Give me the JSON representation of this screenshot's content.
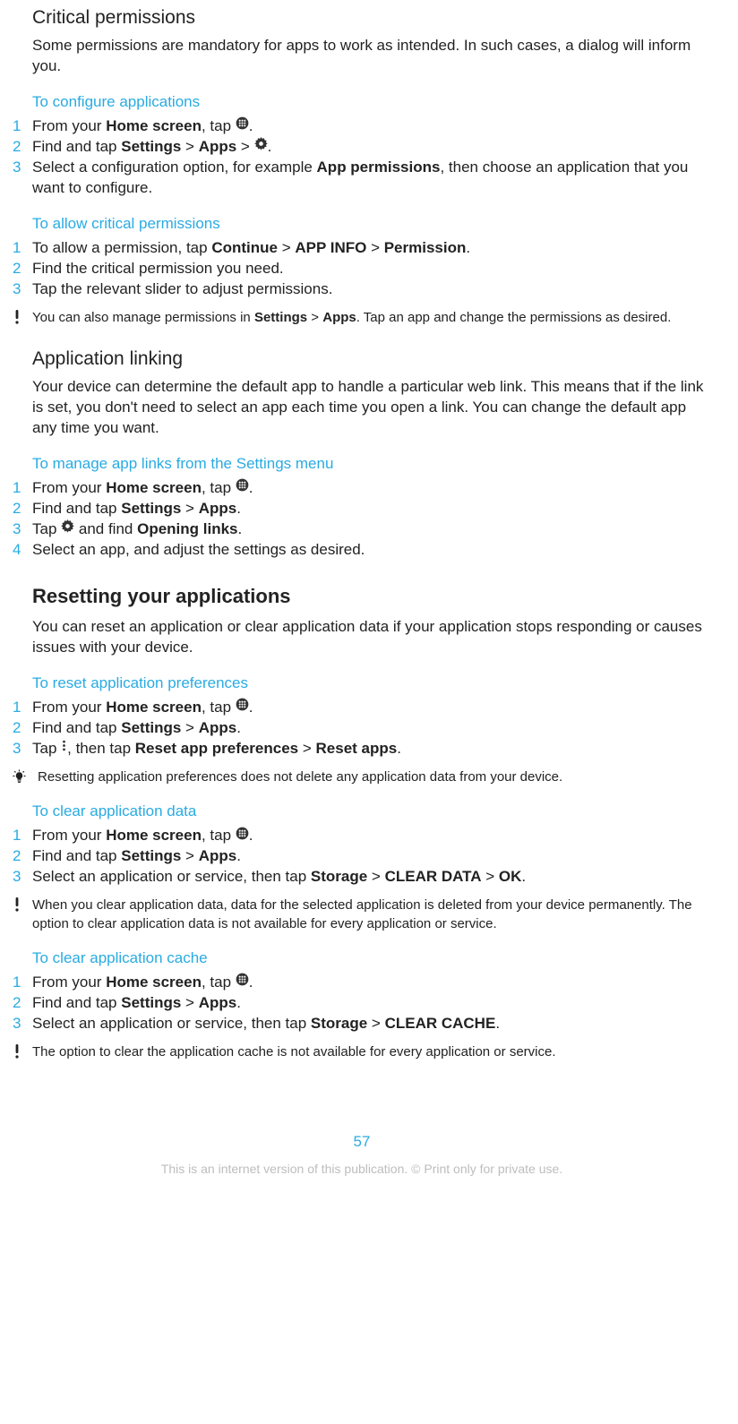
{
  "sections": {
    "critical": {
      "title": "Critical permissions",
      "intro": "Some permissions are mandatory for apps to work as intended. In such cases, a dialog will inform you."
    },
    "configure": {
      "title": "To configure applications",
      "step1_a": "From your ",
      "step1_b": "Home screen",
      "step1_c": ", tap ",
      "step2_a": "Find and tap ",
      "step2_b": "Settings",
      "step2_c": " > ",
      "step2_d": "Apps",
      "step2_e": " > ",
      "step3_a": "Select a configuration option, for example ",
      "step3_b": "App permissions",
      "step3_c": ", then choose an application that you want to configure."
    },
    "allow": {
      "title": "To allow critical permissions",
      "step1_a": "To allow a permission, tap ",
      "step1_b": "Continue",
      "step1_c": " > ",
      "step1_d": "APP INFO",
      "step1_e": " > ",
      "step1_f": "Permission",
      "step1_g": ".",
      "step2": "Find the critical permission you need.",
      "step3": "Tap the relevant slider to adjust permissions.",
      "note_a": "You can also manage permissions in ",
      "note_b": "Settings",
      "note_c": " > ",
      "note_d": "Apps",
      "note_e": ". Tap an app and change the permissions as desired."
    },
    "linking": {
      "title": "Application linking",
      "intro": "Your device can determine the default app to handle a particular web link. This means that if the link is set, you don't need to select an app each time you open a link. You can change the default app any time you want.",
      "sub": "To manage app links from the Settings menu",
      "step1_a": "From your ",
      "step1_b": "Home screen",
      "step1_c": ", tap ",
      "step2_a": "Find and tap ",
      "step2_b": "Settings",
      "step2_c": " > ",
      "step2_d": "Apps",
      "step2_e": ".",
      "step3_a": "Tap ",
      "step3_b": " and find ",
      "step3_c": "Opening links",
      "step3_d": ".",
      "step4": "Select an app, and adjust the settings as desired."
    },
    "reset": {
      "title": "Resetting your applications",
      "intro": "You can reset an application or clear application data if your application stops responding or causes issues with your device."
    },
    "resetprefs": {
      "title": "To reset application preferences",
      "step1_a": "From your ",
      "step1_b": "Home screen",
      "step1_c": ", tap ",
      "step2_a": "Find and tap ",
      "step2_b": "Settings",
      "step2_c": " > ",
      "step2_d": "Apps",
      "step2_e": ".",
      "step3_a": "Tap ",
      "step3_b": ", then tap ",
      "step3_c": "Reset app preferences",
      "step3_d": " > ",
      "step3_e": "Reset apps",
      "step3_f": ".",
      "note": "Resetting application preferences does not delete any application data from your device."
    },
    "cleardata": {
      "title": "To clear application data",
      "step1_a": "From your ",
      "step1_b": "Home screen",
      "step1_c": ", tap ",
      "step2_a": "Find and tap ",
      "step2_b": "Settings",
      "step2_c": " > ",
      "step2_d": "Apps",
      "step2_e": ".",
      "step3_a": "Select an application or service, then tap ",
      "step3_b": "Storage",
      "step3_c": " > ",
      "step3_d": "CLEAR DATA",
      "step3_e": " > ",
      "step3_f": "OK",
      "step3_g": ".",
      "note": "When you clear application data, data for the selected application is deleted from your device permanently. The option to clear application data is not available for every application or service."
    },
    "clearcache": {
      "title": "To clear application cache",
      "step1_a": "From your ",
      "step1_b": "Home screen",
      "step1_c": ", tap ",
      "step2_a": "Find and tap ",
      "step2_b": "Settings",
      "step2_c": " > ",
      "step2_d": "Apps",
      "step2_e": ".",
      "step3_a": "Select an application or service, then tap ",
      "step3_b": "Storage",
      "step3_c": " > ",
      "step3_d": "CLEAR CACHE",
      "step3_e": ".",
      "note": "The option to clear the application cache is not available for every application or service."
    }
  },
  "page_number": "57",
  "footer": "This is an internet version of this publication. © Print only for private use.",
  "nums": {
    "1": "1",
    "2": "2",
    "3": "3",
    "4": "4"
  },
  "period": "."
}
